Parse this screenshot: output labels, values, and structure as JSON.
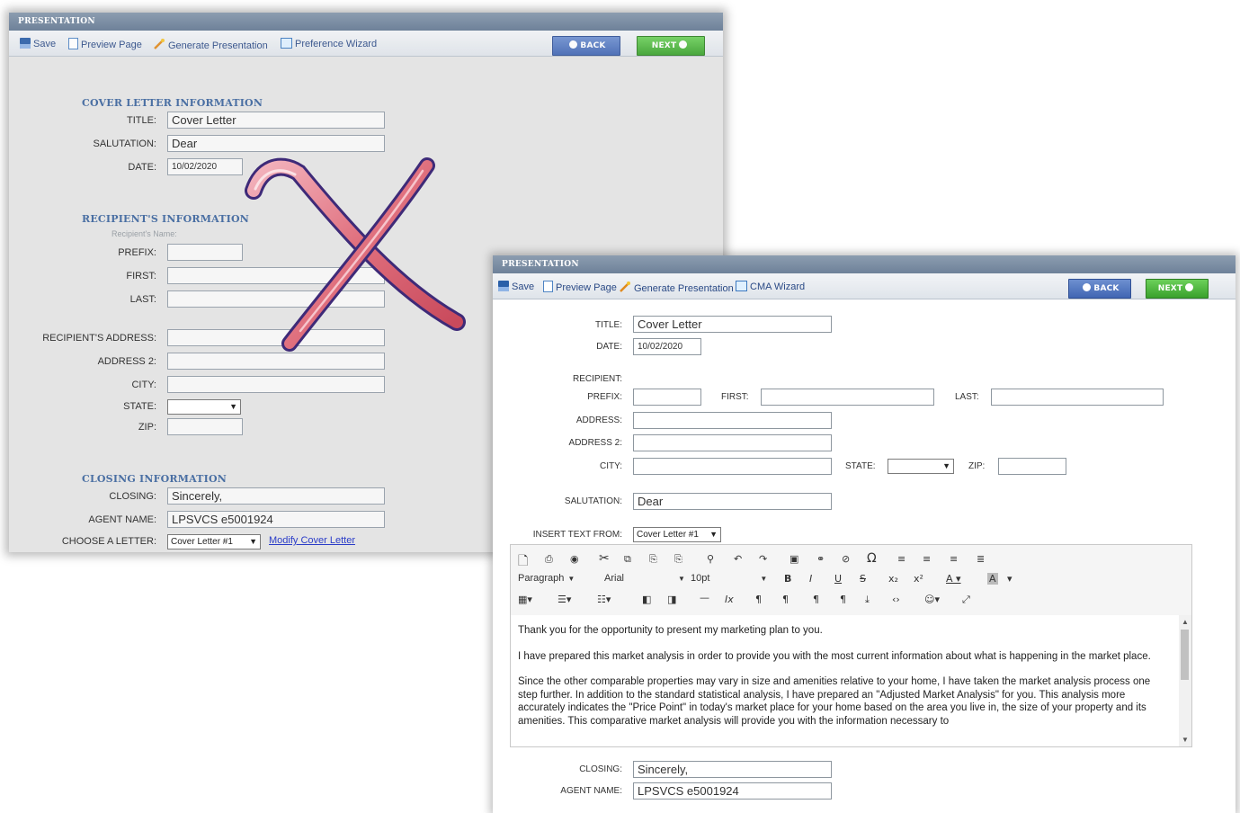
{
  "old_window": {
    "title": "PRESENTATION",
    "toolbar": {
      "save": "Save",
      "preview": "Preview Page",
      "generate": "Generate Presentation",
      "wizard": "Preference Wizard"
    },
    "back_label": "BACK",
    "next_label": "NEXT",
    "cover_section": "COVER LETTER INFORMATION",
    "title_label": "TITLE:",
    "title_value": "Cover Letter",
    "salutation_label": "SALUTATION:",
    "salutation_value": "Dear",
    "date_label": "DATE:",
    "date_value": "10/02/2020",
    "recipient_section": "RECIPIENT'S INFORMATION",
    "recipient_hint": "Recipient's Name:",
    "prefix_label": "PREFIX:",
    "first_label": "FIRST:",
    "last_label": "LAST:",
    "address_label": "RECIPIENT'S ADDRESS:",
    "address2_label": "ADDRESS 2:",
    "city_label": "CITY:",
    "state_label": "STATE:",
    "zip_label": "ZIP:",
    "closing_section": "CLOSING INFORMATION",
    "closing_label": "CLOSING:",
    "closing_value": "Sincerely,",
    "agent_label": "AGENT NAME:",
    "agent_value": "LPSVCS e5001924",
    "letter_label": "CHOOSE A LETTER:",
    "letter_value": "Cover Letter #1",
    "modify_link": "Modify Cover Letter",
    "overlay_color": "#e0707e"
  },
  "new_window": {
    "title": "PRESENTATION",
    "toolbar": {
      "save": "Save",
      "preview": "Preview Page",
      "generate": "Generate Presentation",
      "wizard": "CMA Wizard"
    },
    "back_label": "BACK",
    "next_label": "NEXT",
    "title_label": "TITLE:",
    "title_value": "Cover Letter",
    "date_label": "DATE:",
    "date_value": "10/02/2020",
    "recipient_label": "RECIPIENT:",
    "prefix_label": "PREFIX:",
    "first_label": "FIRST:",
    "last_label": "LAST:",
    "address_label": "ADDRESS:",
    "address2_label": "ADDRESS 2:",
    "city_label": "CITY:",
    "state_label": "STATE:",
    "zip_label": "ZIP:",
    "salutation_label": "SALUTATION:",
    "salutation_value": "Dear",
    "insert_label": "INSERT TEXT FROM:",
    "insert_value": "Cover Letter #1",
    "editor": {
      "format": "Paragraph",
      "font": "Arial",
      "size": "10pt",
      "paragraphs": [
        "Thank you for the opportunity to present my marketing plan to you.",
        "I have prepared this market analysis in order to provide you with the most current information about what is happening in the market place.",
        "Since the other comparable properties may vary in size and amenities relative to your home, I have taken the market analysis process one step further. In addition to the standard statistical analysis, I have prepared an \"Adjusted Market Analysis\" for you. This analysis more accurately indicates the \"Price Point\" in today's market place for your home based on the area you live in, the size of your property and its amenities. This comparative market analysis will provide you with the information necessary to"
      ]
    },
    "closing_label": "CLOSING:",
    "closing_value": "Sincerely,",
    "agent_label": "AGENT NAME:",
    "agent_value": "LPSVCS e5001924"
  },
  "colors": {
    "titlebar": "#7a8ca3",
    "back_button": "#4f74bf",
    "next_button": "#4dba3c",
    "section_heading": "#4a6fa3",
    "link": "#2a3cc8"
  }
}
